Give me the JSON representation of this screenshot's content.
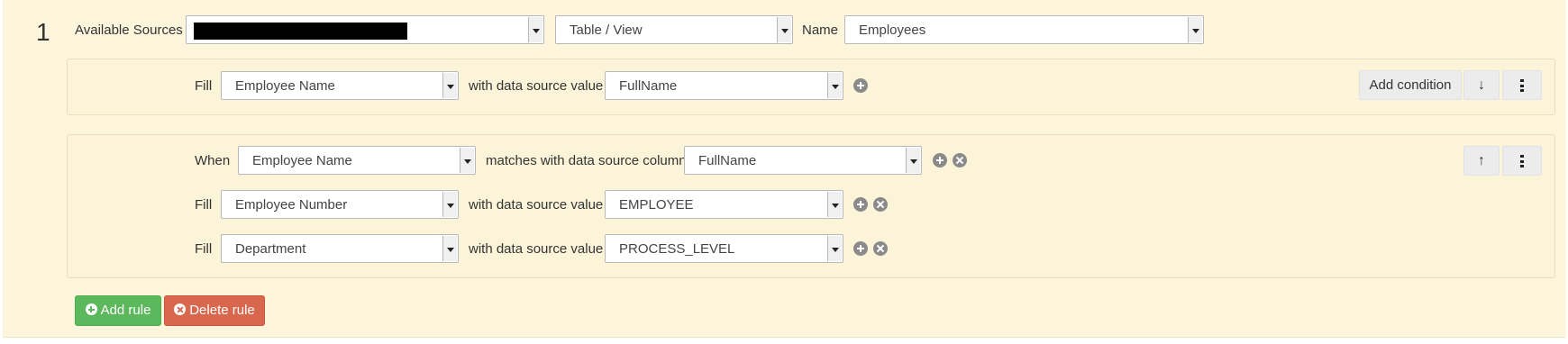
{
  "rule": {
    "number": "1",
    "available_sources_label": "Available Sources",
    "source_value": "",
    "type_value": "Table / View",
    "name_label": "Name",
    "name_value": "Employees"
  },
  "fill_panel": {
    "fill_label": "Fill",
    "field_value": "Employee Name",
    "with_label": "with data source value",
    "source_column": "FullName",
    "add_condition_label": "Add condition"
  },
  "condition_panel": {
    "when_label": "When",
    "when_field": "Employee Name",
    "matches_label": "matches with data source column",
    "when_column": "FullName",
    "fills": [
      {
        "label": "Fill",
        "field": "Employee Number",
        "with_label": "with data source value",
        "value": "EMPLOYEE"
      },
      {
        "label": "Fill",
        "field": "Department",
        "with_label": "with data source value",
        "value": "PROCESS_LEVEL"
      }
    ]
  },
  "actions": {
    "add_rule_label": "Add rule",
    "delete_rule_label": "Delete rule"
  },
  "icons": {
    "add": "plus-circle-icon",
    "remove": "times-circle-icon",
    "move_down": "arrow-down-icon",
    "move_up": "arrow-up-icon",
    "more": "kebab-menu-icon"
  },
  "colors": {
    "panel_bg": "#fdf6dc",
    "add_rule": "#5cb85c",
    "delete_rule": "#d9674e"
  }
}
